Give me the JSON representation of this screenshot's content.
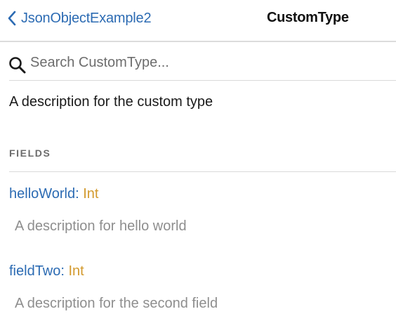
{
  "header": {
    "back_label": "JsonObjectExample2",
    "title": "CustomType"
  },
  "search": {
    "placeholder": "Search CustomType..."
  },
  "type_description": "A description for the custom type",
  "fields_section": {
    "heading": "FIELDS",
    "fields": [
      {
        "name": "helloWorld",
        "colon": ":",
        "type": "Int",
        "description": "A description for hello world"
      },
      {
        "name": "fieldTwo",
        "colon": ":",
        "type": "Int",
        "description": "A description for the second field"
      }
    ]
  },
  "colors": {
    "link": "#2c6bb3",
    "type": "#d39a2e",
    "muted": "#8e8e8e"
  },
  "icons": {
    "back": "chevron-left-icon",
    "search": "search-icon"
  }
}
